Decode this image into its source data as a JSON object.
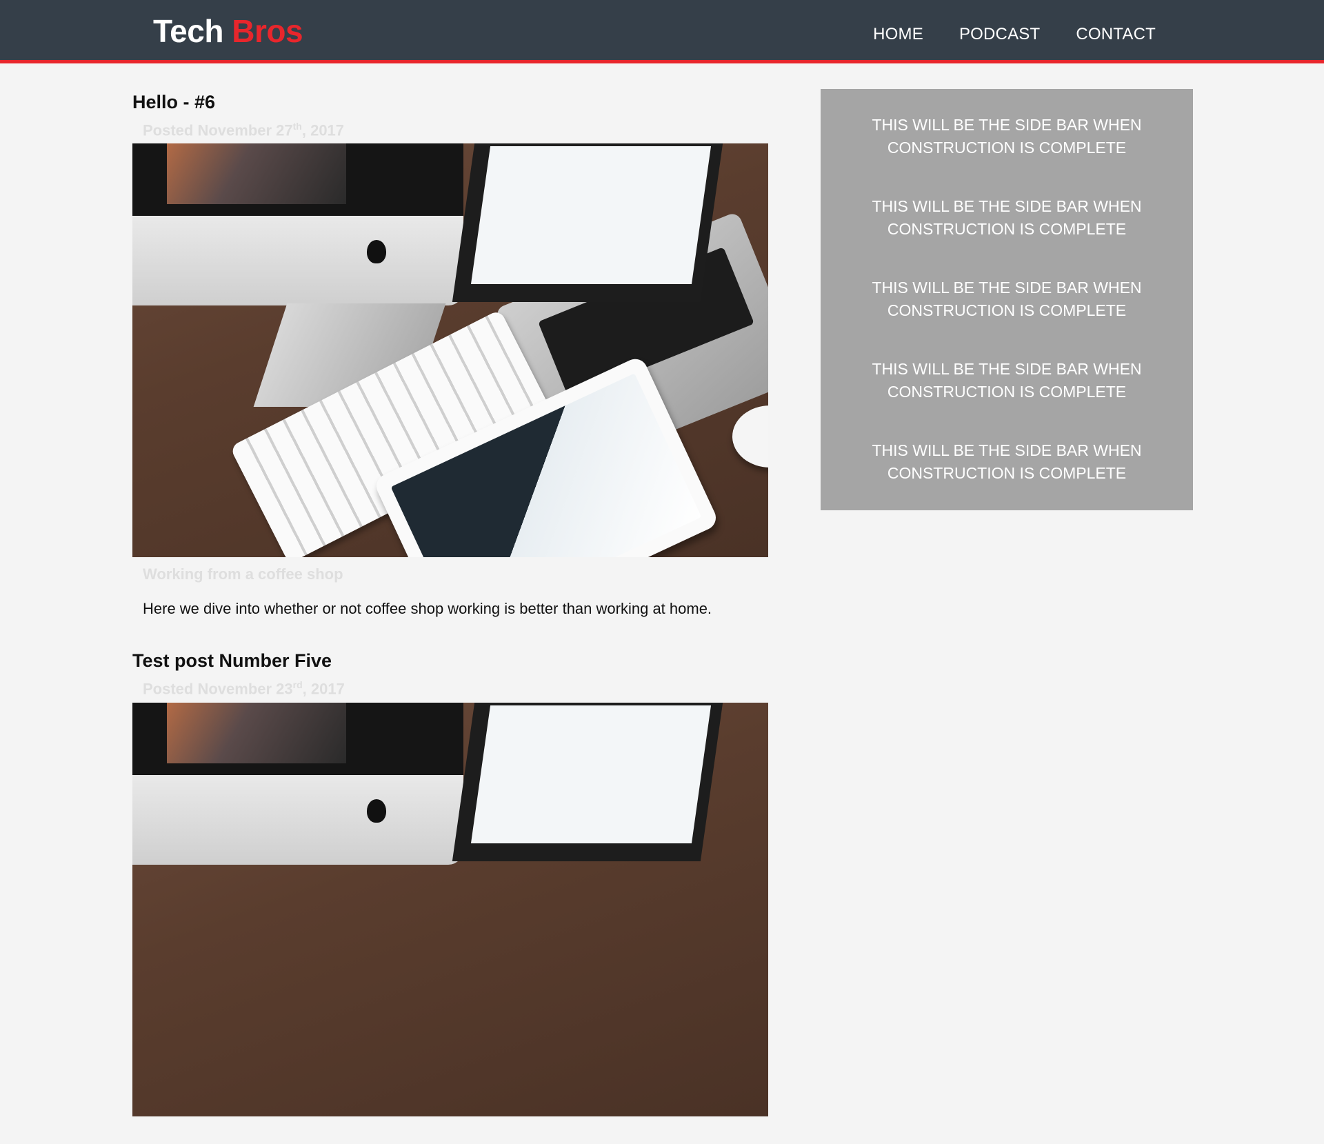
{
  "header": {
    "logo_primary": "Tech",
    "logo_accent": "Bros",
    "nav": [
      {
        "label": "HOME"
      },
      {
        "label": "PODCAST"
      },
      {
        "label": "CONTACT"
      }
    ]
  },
  "posts": [
    {
      "title": "Hello - #6",
      "date_prefix": "Posted November 27",
      "date_suffix": "th",
      "date_year": ", 2017",
      "caption": "Working from a coffee shop",
      "body": "Here we dive into whether or not coffee shop working is better than working at home."
    },
    {
      "title": "Test post Number Five",
      "date_prefix": "Posted November 23",
      "date_suffix": "rd",
      "date_year": ", 2017"
    }
  ],
  "sidebar": {
    "items": [
      {
        "text": "THIS WILL BE THE SIDE BAR WHEN CONSTRUCTION IS COMPLETE"
      },
      {
        "text": "THIS WILL BE THE SIDE BAR WHEN CONSTRUCTION IS COMPLETE"
      },
      {
        "text": "THIS WILL BE THE SIDE BAR WHEN CONSTRUCTION IS COMPLETE"
      },
      {
        "text": "THIS WILL BE THE SIDE BAR WHEN CONSTRUCTION IS COMPLETE"
      },
      {
        "text": "THIS WILL BE THE SIDE BAR WHEN CONSTRUCTION IS COMPLETE"
      }
    ]
  },
  "colors": {
    "header_bg": "#353f49",
    "accent": "#e8262c",
    "sidebar_bg": "#a5a5a5",
    "page_bg": "#f4f4f4"
  }
}
